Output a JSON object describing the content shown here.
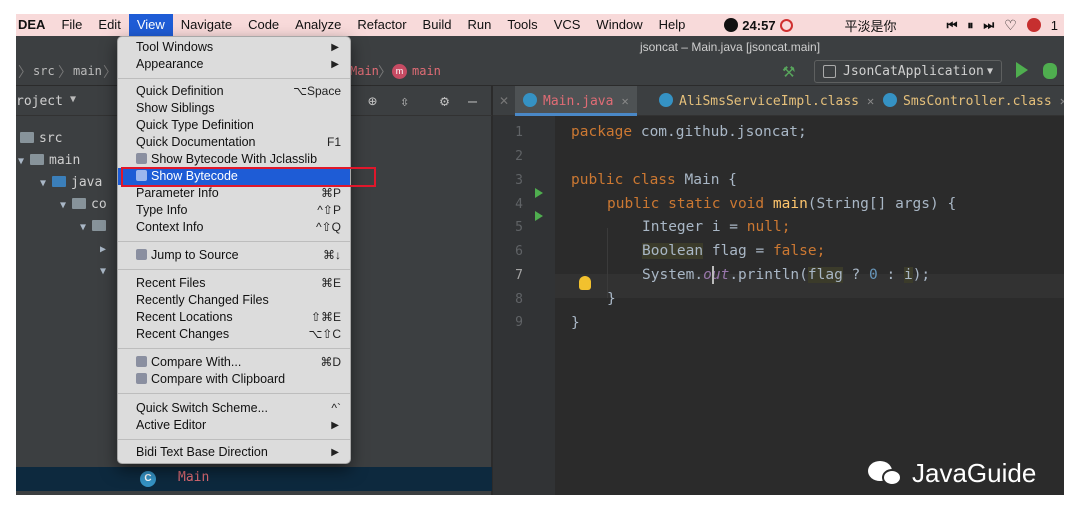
{
  "menubar": {
    "app": "DEA",
    "items": [
      "File",
      "Edit",
      "View",
      "Navigate",
      "Code",
      "Analyze",
      "Refactor",
      "Build",
      "Run",
      "Tools",
      "VCS",
      "Window",
      "Help"
    ],
    "active_item": "View",
    "clock": "24:57",
    "song": "平淡是你",
    "right_trunc": "1"
  },
  "window": {
    "title": "jsoncat – Main.java [jsoncat.main]"
  },
  "navbar": {
    "crumbs": [
      "src",
      "main"
    ],
    "crumbs_after_menu": [
      "Main",
      "main"
    ],
    "run_config": "JsonCatApplication"
  },
  "project": {
    "header": "roject",
    "tree": [
      "src",
      "main",
      "java",
      "co"
    ],
    "selected": "Main"
  },
  "tabs": [
    {
      "label": "Main.java",
      "active": true
    },
    {
      "label": "AliSmsServiceImpl.class",
      "active": false
    },
    {
      "label": "SmsController.class",
      "active": false
    }
  ],
  "editor": {
    "line_numbers": [
      "1",
      "2",
      "3",
      "4",
      "5",
      "6",
      "7",
      "8",
      "9"
    ],
    "code": {
      "l1_kw": "package ",
      "l1_rest": "com.github.jsoncat;",
      "l3_kw": "public class ",
      "l3_rest": "Main {",
      "l4_kw1": "public static void ",
      "l4_fn": "main",
      "l4_rest": "(String[] args) {",
      "l5_type": "Integer i = ",
      "l5_kw": "null",
      "l5_end": ";",
      "l6_type": "Boolean",
      "l6_mid": " flag = ",
      "l6_kw": "false",
      "l6_end": ";",
      "l7_pre": "System.",
      "l7_field": "out",
      "l7_mid": ".println(",
      "l7_flag": "flag",
      "l7_q": " ? ",
      "l7_n0": "0",
      "l7_colon": " : ",
      "l7_i": "i",
      "l7_end": ");",
      "l8": "}",
      "l9": "}"
    }
  },
  "view_menu": {
    "items": [
      {
        "label": "Tool Windows",
        "shortcut": "",
        "submenu": true
      },
      {
        "label": "Appearance",
        "shortcut": "",
        "submenu": true
      },
      {
        "label": "Quick Definition",
        "shortcut": "⌥Space"
      },
      {
        "label": "Show Siblings",
        "shortcut": ""
      },
      {
        "label": "Quick Type Definition",
        "shortcut": ""
      },
      {
        "label": "Quick Documentation",
        "shortcut": "F1"
      },
      {
        "label": "Show Bytecode With Jclasslib",
        "shortcut": ""
      },
      {
        "label": "Show Bytecode",
        "shortcut": "",
        "highlighted": true
      },
      {
        "label": "Parameter Info",
        "shortcut": "⌘P"
      },
      {
        "label": "Type Info",
        "shortcut": "^⇧P"
      },
      {
        "label": "Context Info",
        "shortcut": "^⇧Q"
      },
      {
        "label": "Jump to Source",
        "shortcut": "⌘↓"
      },
      {
        "label": "Recent Files",
        "shortcut": "⌘E"
      },
      {
        "label": "Recently Changed Files",
        "shortcut": ""
      },
      {
        "label": "Recent Locations",
        "shortcut": "⇧⌘E"
      },
      {
        "label": "Recent Changes",
        "shortcut": "⌥⇧C"
      },
      {
        "label": "Compare With...",
        "shortcut": "⌘D"
      },
      {
        "label": "Compare with Clipboard",
        "shortcut": ""
      },
      {
        "label": "Quick Switch Scheme...",
        "shortcut": "^`"
      },
      {
        "label": "Active Editor",
        "shortcut": "",
        "submenu": true
      },
      {
        "label": "Bidi Text Base Direction",
        "shortcut": "",
        "submenu": true
      }
    ]
  },
  "watermark": "JavaGuide",
  "colors": {
    "menubar_bg": "#f8dada",
    "menu_highlight": "#1e5cd6",
    "annotation_red": "#e0172b",
    "editor_bg": "#2b2b2b"
  }
}
